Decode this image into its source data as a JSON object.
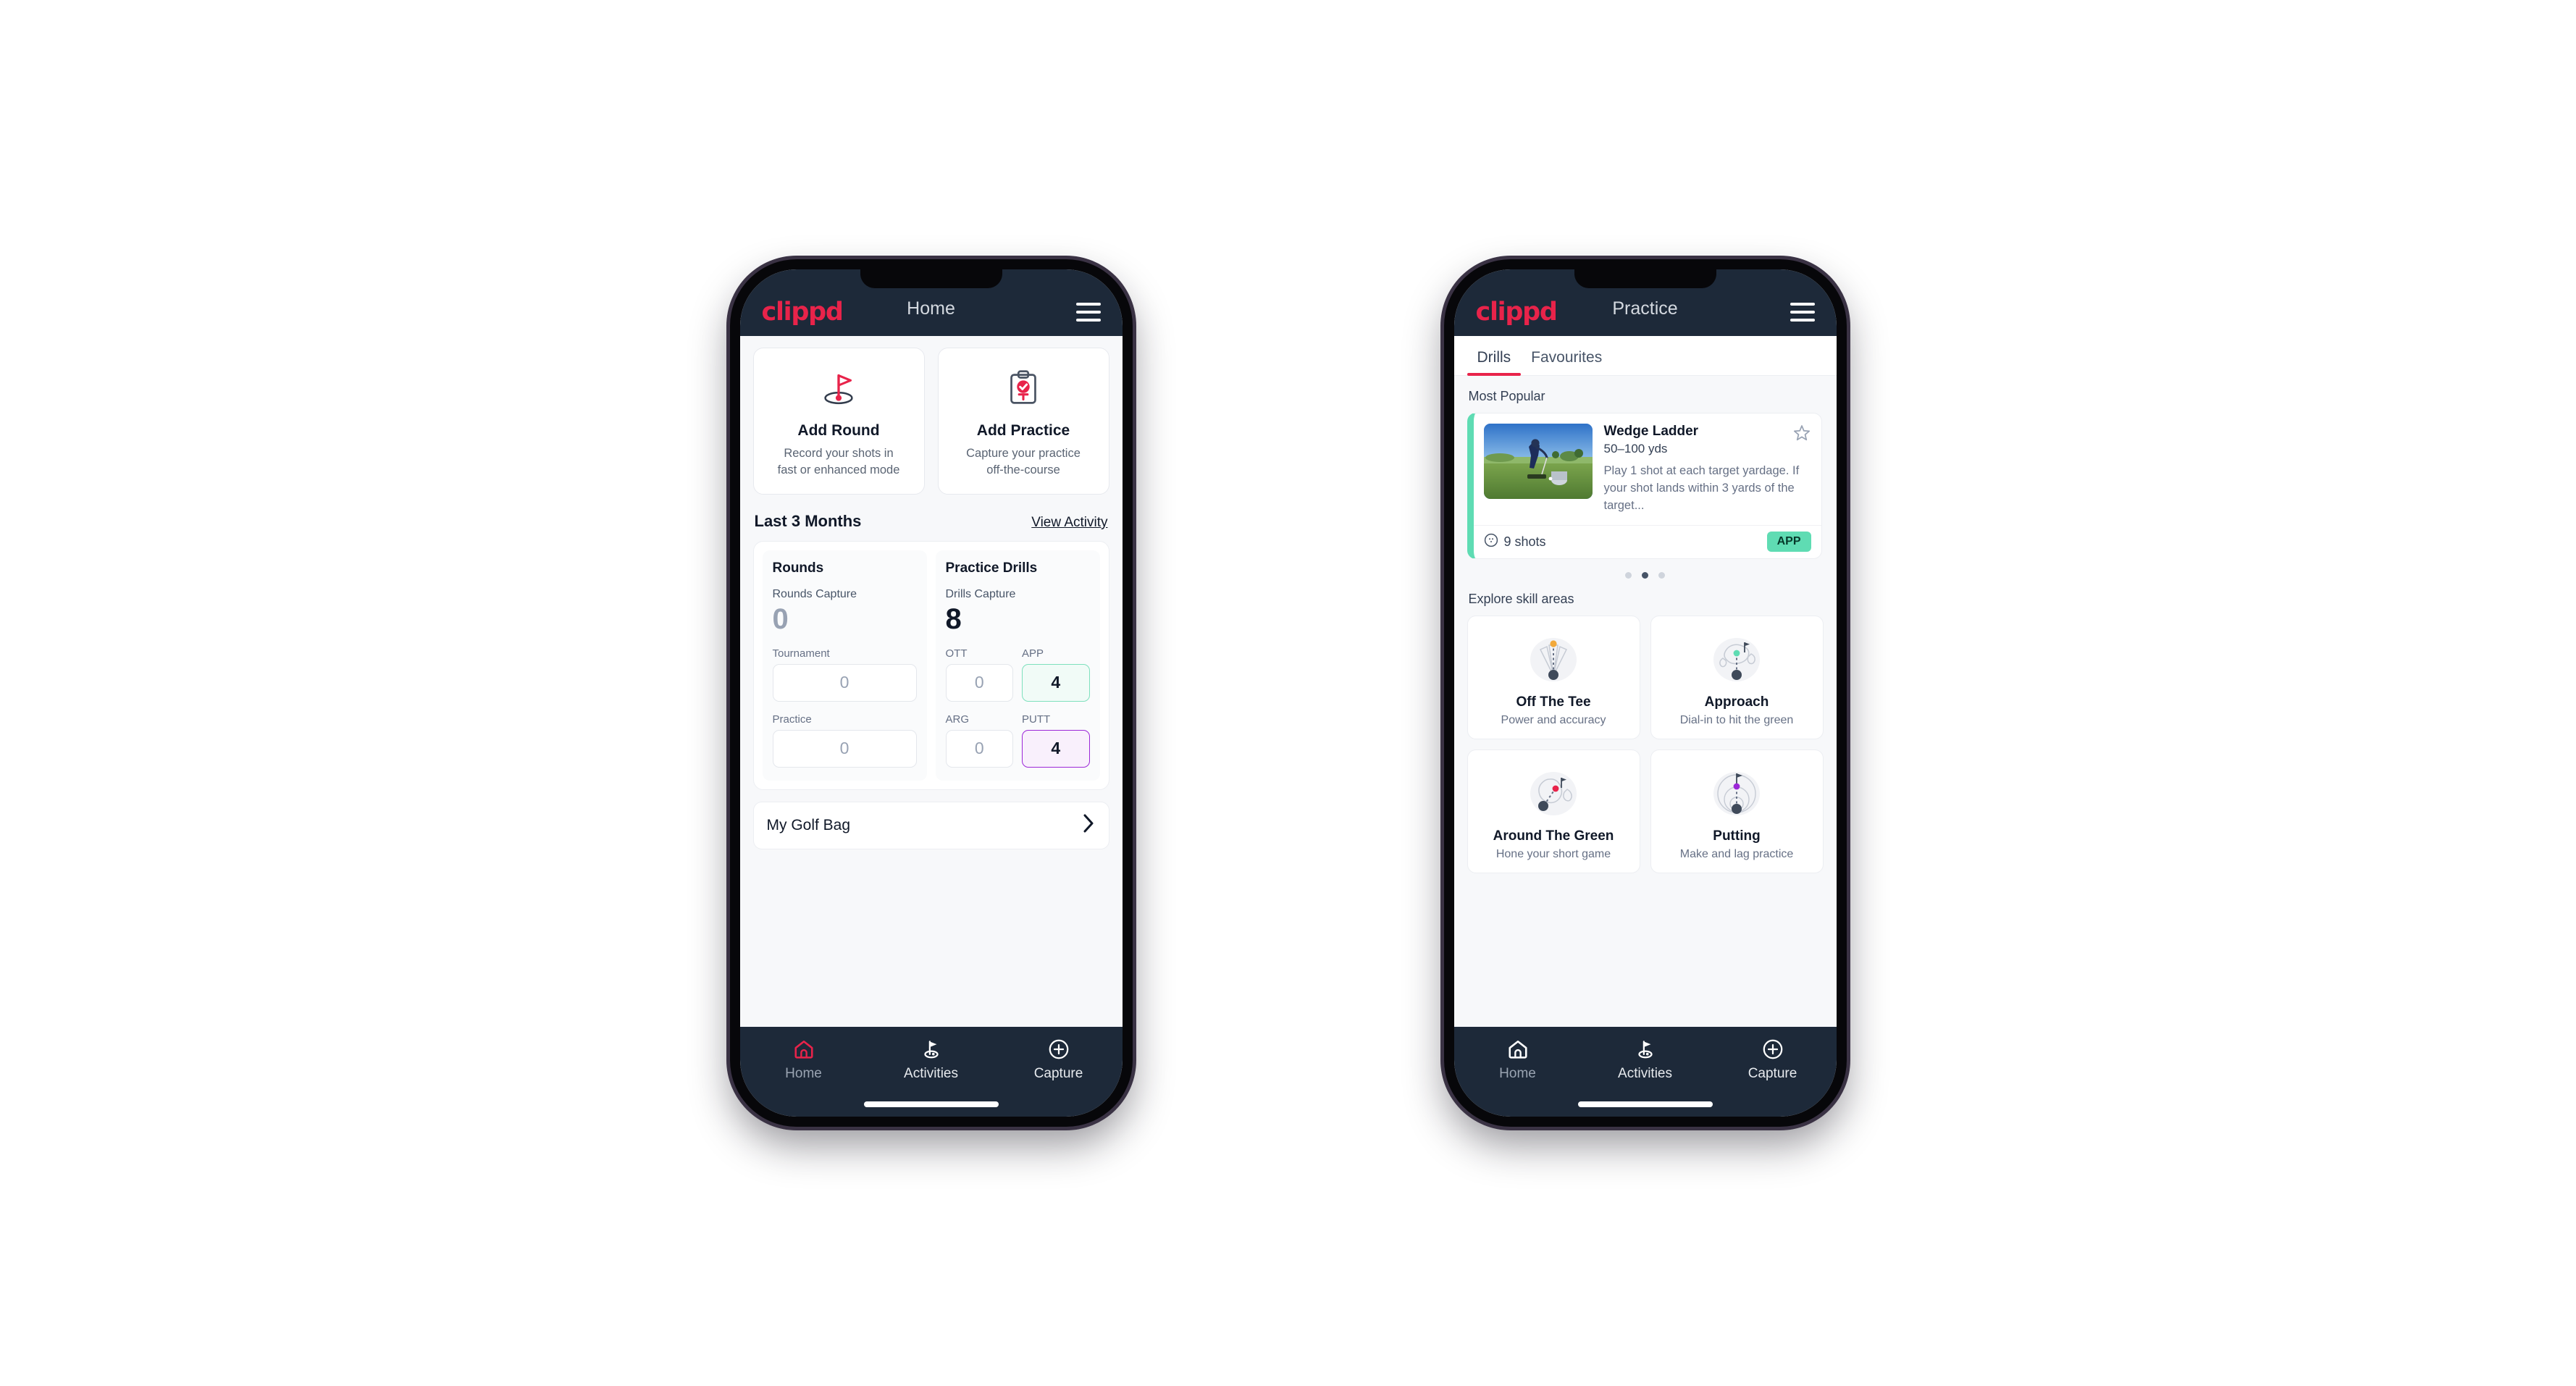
{
  "colors": {
    "brand_pink": "#e8234a",
    "appbar_dark": "#1d2939",
    "accent_green": "#5fdcb3",
    "accent_purple": "#9c27d8",
    "page_bg": "#f7f8fa"
  },
  "home_phone": {
    "appbar": {
      "brand": "clippd",
      "title": "Home",
      "menu_icon": "hamburger-icon"
    },
    "quick_actions": [
      {
        "icon": "golf-flag-hole-icon",
        "title": "Add Round",
        "subtitle_line1": "Record your shots in",
        "subtitle_line2": "fast or enhanced mode"
      },
      {
        "icon": "clipboard-check-icon",
        "title": "Add Practice",
        "subtitle_line1": "Capture your practice",
        "subtitle_line2": "off-the-course"
      }
    ],
    "section": {
      "title": "Last 3 Months",
      "link": "View Activity"
    },
    "stats": {
      "rounds": {
        "heading": "Rounds",
        "capture_label": "Rounds Capture",
        "capture_value": "0",
        "fields": [
          {
            "label": "Tournament",
            "value": "0",
            "style": "plain"
          },
          {
            "label": "Practice",
            "value": "0",
            "style": "plain"
          }
        ]
      },
      "drills": {
        "heading": "Practice Drills",
        "capture_label": "Drills Capture",
        "capture_value": "8",
        "fields": [
          {
            "label": "OTT",
            "value": "0",
            "style": "plain"
          },
          {
            "label": "APP",
            "value": "4",
            "style": "green"
          },
          {
            "label": "ARG",
            "value": "0",
            "style": "plain"
          },
          {
            "label": "PUTT",
            "value": "4",
            "style": "purple"
          }
        ]
      }
    },
    "golf_bag": {
      "label": "My Golf Bag",
      "chevron_icon": "chevron-right-icon"
    },
    "bottom_nav": [
      {
        "icon": "home-icon",
        "label": "Home",
        "active": true
      },
      {
        "icon": "golf-flag-icon",
        "label": "Activities",
        "active": false
      },
      {
        "icon": "plus-circle-icon",
        "label": "Capture",
        "active": false
      }
    ]
  },
  "practice_phone": {
    "appbar": {
      "brand": "clippd",
      "title": "Practice",
      "menu_icon": "hamburger-icon"
    },
    "tabs": [
      {
        "label": "Drills",
        "active": true
      },
      {
        "label": "Favourites",
        "active": false
      }
    ],
    "most_popular": {
      "label": "Most Popular",
      "drill": {
        "name": "Wedge Ladder",
        "yards": "50–100 yds",
        "description": "Play 1 shot at each target yardage. If your shot lands within 3 yards of the target...",
        "shots_icon": "golf-ball-icon",
        "shots": "9 shots",
        "badge": "APP",
        "star_icon": "star-outline-icon",
        "accent": "#5fdcb3",
        "thumbnail": "golfer-chipping-photo"
      },
      "peek_accent": "#9c27d8",
      "dots": [
        {
          "active": false
        },
        {
          "active": true
        },
        {
          "active": false
        }
      ]
    },
    "skill_areas": {
      "label": "Explore skill areas",
      "cards": [
        {
          "icon": "tee-shot-fan-icon",
          "title": "Off The Tee",
          "subtitle": "Power and accuracy",
          "dot_color": "#f2a93b"
        },
        {
          "icon": "green-approach-icon",
          "title": "Approach",
          "subtitle": "Dial-in to hit the green",
          "dot_color": "#5fdcb3"
        },
        {
          "icon": "chip-around-green-icon",
          "title": "Around The Green",
          "subtitle": "Hone your short game",
          "dot_color": "#e8234a"
        },
        {
          "icon": "putting-rings-icon",
          "title": "Putting",
          "subtitle": "Make and lag practice",
          "dot_color": "#9c27d8"
        }
      ]
    },
    "bottom_nav": [
      {
        "icon": "home-icon",
        "label": "Home",
        "active": false
      },
      {
        "icon": "golf-flag-icon",
        "label": "Activities",
        "active": false
      },
      {
        "icon": "plus-circle-icon",
        "label": "Capture",
        "active": false
      }
    ]
  }
}
